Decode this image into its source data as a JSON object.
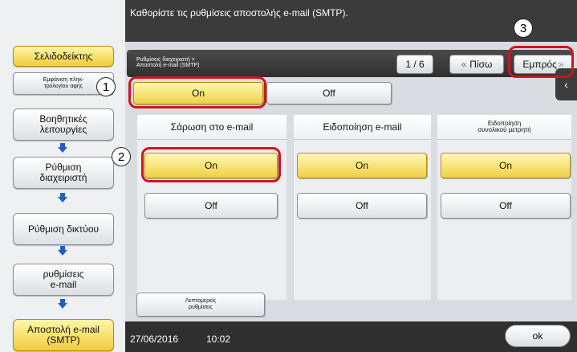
{
  "header": {
    "title": "Καθορίστε τις ρυθμίσεις αποστολής e-mail (SMTP)."
  },
  "sidebar": {
    "bookmark": "Σελιδοδείκτης",
    "counter_display": "Εμφάνιση πληκ-\nτρολογίου αφής",
    "items": [
      {
        "label": "Βοηθητικές\nλειτουργίες"
      },
      {
        "label": "Ρύθμιση\nδιαχειριστή"
      },
      {
        "label": "Ρύθμιση δικτύου"
      },
      {
        "label": "ρυθμίσεις\ne-mail"
      },
      {
        "label": "Αποστολή e-mail\n(SMTP)"
      }
    ]
  },
  "nav": {
    "breadcrumb": "Ρυθμίσεις διαχειριστή >\nΑποστολή e-mail (SMTP)",
    "page": "1 / 6",
    "back": "Πίσω",
    "forward": "Εμπρός"
  },
  "smtp_toggle": {
    "on": "On",
    "off": "Off",
    "selected": "On"
  },
  "columns": [
    {
      "title": "Σάρωση στο e-mail",
      "on": "On",
      "off": "Off",
      "selected": "On"
    },
    {
      "title": "Ειδοποίηση e-mail",
      "on": "On",
      "off": "Off",
      "selected": "On"
    },
    {
      "title": "Ειδοποίηση\nσυνολικού μετρητή",
      "on": "On",
      "off": "Off",
      "selected": "On"
    }
  ],
  "details_button": "Λεπτομερείς\nρυθμίσεις",
  "footer": {
    "date": "27/06/2016",
    "time": "10:02",
    "ok": "ok"
  },
  "callouts": [
    "1",
    "2",
    "3"
  ],
  "colors": {
    "callout": "#d0151b",
    "selected": "#efd145",
    "dark_bar": "#2f2f2f"
  }
}
